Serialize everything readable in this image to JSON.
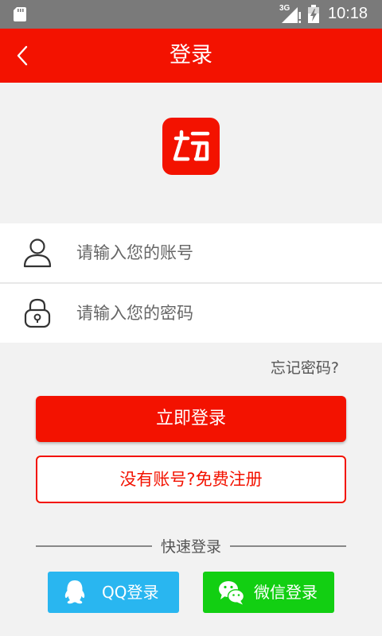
{
  "status_bar": {
    "network": "3G",
    "time": "10:18"
  },
  "header": {
    "title": "登录"
  },
  "form": {
    "account_placeholder": "请输入您的账号",
    "password_placeholder": "请输入您的密码",
    "forgot_password": "忘记密码?"
  },
  "actions": {
    "login_label": "立即登录",
    "register_label": "没有账号?免费注册"
  },
  "quick_login": {
    "title": "快速登录",
    "qq_label": "QQ登录",
    "wechat_label": "微信登录"
  },
  "colors": {
    "primary_red": "#f31200",
    "qq_blue": "#29b6f0",
    "wechat_green": "#12cf12",
    "status_bar_gray": "#7a7a7a",
    "background": "#f2f2f2"
  },
  "icons": {
    "status_bar": [
      "sd-card-icon",
      "signal-icon",
      "battery-icon"
    ],
    "header": "back-arrow-icon",
    "logo": "app-logo",
    "account": "user-icon",
    "password": "lock-icon",
    "qq": "qq-icon",
    "wechat": "wechat-icon"
  }
}
